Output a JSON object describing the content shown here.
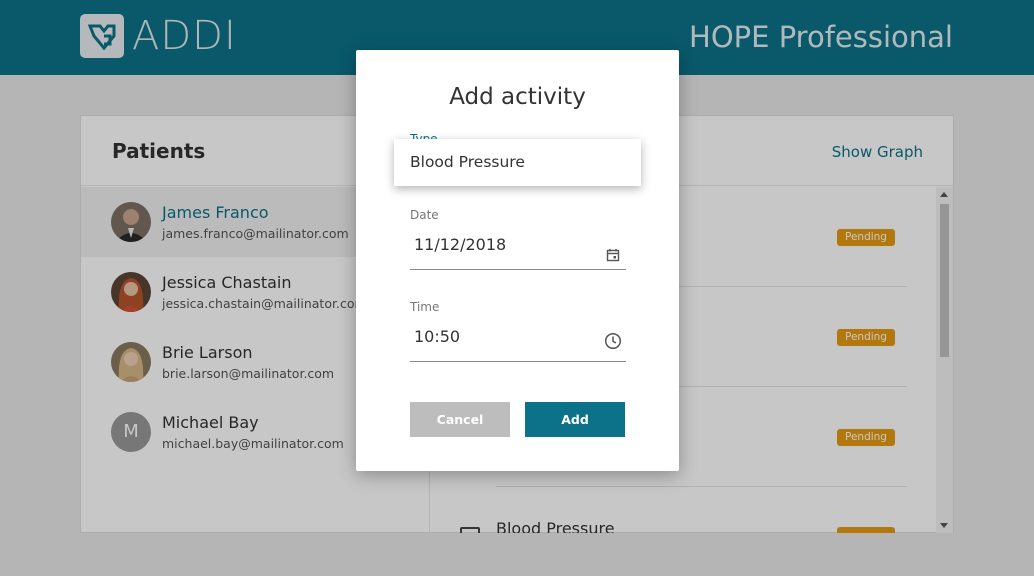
{
  "header": {
    "brand": "ADDI",
    "product": "HOPE Professional"
  },
  "patients": {
    "title": "Patients",
    "show_graph": "Show Graph",
    "items": [
      {
        "name": "James Franco",
        "email": "james.franco@mailinator.com",
        "active": true
      },
      {
        "name": "Jessica Chastain",
        "email": "jessica.chastain@mailinator.com",
        "active": false
      },
      {
        "name": "Brie Larson",
        "email": "brie.larson@mailinator.com",
        "active": false
      },
      {
        "name": "Michael Bay",
        "email": "michael.bay@mailinator.com",
        "active": false,
        "initial": "M"
      }
    ]
  },
  "activities": {
    "badges": [
      "Pending",
      "Pending",
      "Pending"
    ],
    "partial_item_label": "Blood Pressure"
  },
  "modal": {
    "title": "Add activity",
    "type_label": "Type",
    "type_selected": "Blood Pressure",
    "date_label": "Date",
    "date_value": "11/12/2018",
    "time_label": "Time",
    "time_value": "10:50",
    "cancel_label": "Cancel",
    "add_label": "Add"
  },
  "colors": {
    "brand": "#0c7289",
    "pending": "#e59a12",
    "cancel": "#bdbdbd"
  }
}
